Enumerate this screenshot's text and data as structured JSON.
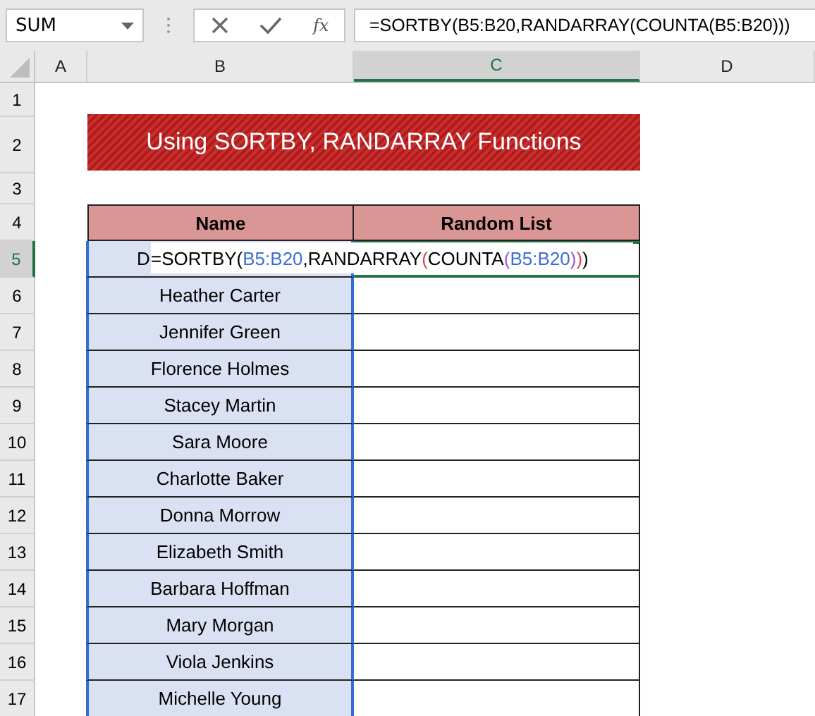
{
  "name_box": {
    "value": "SUM"
  },
  "formula_bar": {
    "function_label": "fx",
    "formula": "=SORTBY(B5:B20,RANDARRAY(COUNTA(B5:B20)))"
  },
  "columns": [
    {
      "label": "A",
      "selected": false
    },
    {
      "label": "B",
      "selected": false
    },
    {
      "label": "C",
      "selected": true
    },
    {
      "label": "D",
      "selected": false
    }
  ],
  "title": "Using SORTBY, RANDARRAY Functions",
  "table": {
    "headers": [
      "Name",
      "Random List"
    ],
    "edit_cell": {
      "value": "D",
      "formula": [
        {
          "text": "=SORTBY(",
          "color": "#000000"
        },
        {
          "text": "B5:B20",
          "color": "#3b6fd6"
        },
        {
          "text": ",RANDARRAY",
          "color": "#000000"
        },
        {
          "text": "(",
          "color": "#e0405a"
        },
        {
          "text": "COUNTA",
          "color": "#000000"
        },
        {
          "text": "(",
          "color": "#9b59d0"
        },
        {
          "text": "B5:B20",
          "color": "#3b6fd6"
        },
        {
          "text": ")",
          "color": "#9b59d0"
        },
        {
          "text": ")",
          "color": "#e0405a"
        },
        {
          "text": ")",
          "color": "#000000"
        }
      ]
    },
    "rows": [
      "Heather Carter",
      "Jennifer Green",
      "Florence Holmes",
      "Stacey Martin",
      "Sara Moore",
      "Charlotte Baker",
      "Donna Morrow",
      "Elizabeth Smith",
      "Barbara Hoffman",
      "Mary Morgan",
      "Viola Jenkins",
      "Michelle Young"
    ]
  },
  "row_numbers": [
    {
      "label": "1",
      "selected": false
    },
    {
      "label": "2",
      "selected": false
    },
    {
      "label": "3",
      "selected": false
    },
    {
      "label": "4",
      "selected": false
    },
    {
      "label": "5",
      "selected": true
    },
    {
      "label": "6",
      "selected": false
    },
    {
      "label": "7",
      "selected": false
    },
    {
      "label": "8",
      "selected": false
    },
    {
      "label": "9",
      "selected": false
    },
    {
      "label": "10",
      "selected": false
    },
    {
      "label": "11",
      "selected": false
    },
    {
      "label": "12",
      "selected": false
    },
    {
      "label": "13",
      "selected": false
    },
    {
      "label": "14",
      "selected": false
    },
    {
      "label": "15",
      "selected": false
    },
    {
      "label": "16",
      "selected": false
    },
    {
      "label": "17",
      "selected": false
    }
  ]
}
